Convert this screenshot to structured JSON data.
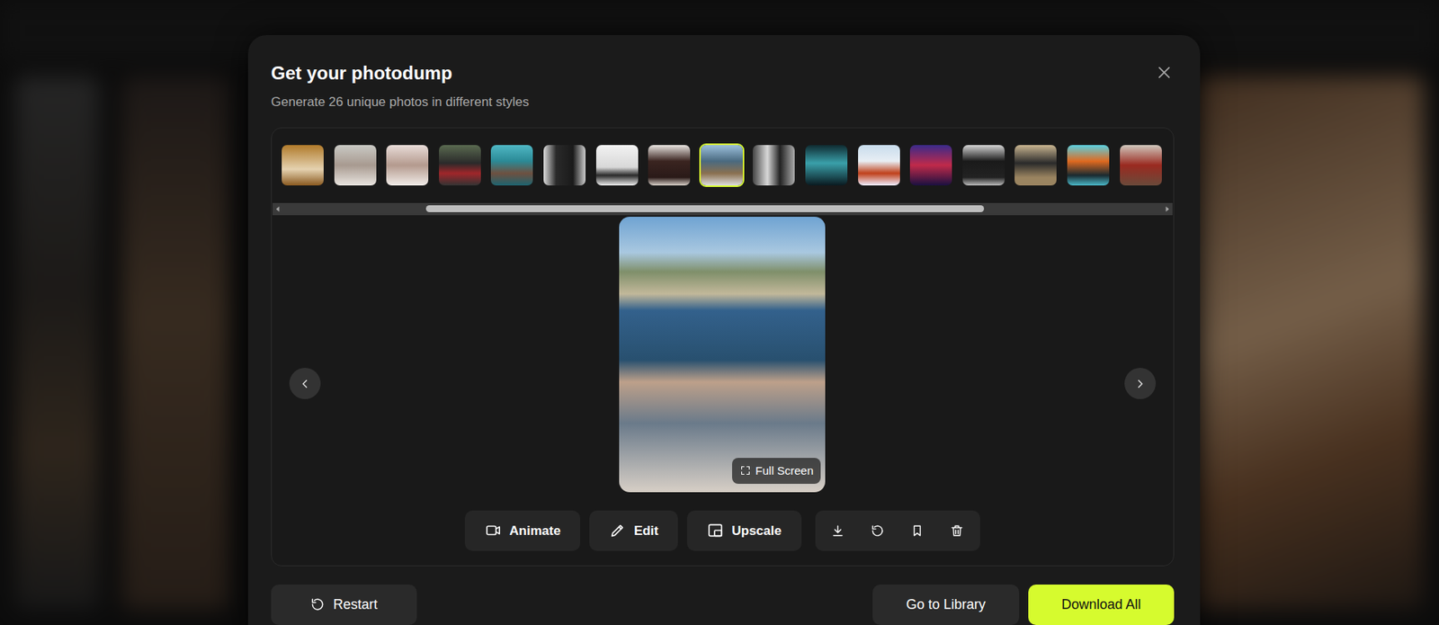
{
  "modal": {
    "title": "Get your photodump",
    "subtitle": "Generate 26 unique photos in different styles"
  },
  "thumbnails": [
    {
      "selected": false
    },
    {
      "selected": false
    },
    {
      "selected": false
    },
    {
      "selected": false
    },
    {
      "selected": false
    },
    {
      "selected": false
    },
    {
      "selected": false
    },
    {
      "selected": false
    },
    {
      "selected": true
    },
    {
      "selected": false
    },
    {
      "selected": false
    },
    {
      "selected": false
    },
    {
      "selected": false
    },
    {
      "selected": false
    },
    {
      "selected": false
    },
    {
      "selected": false
    },
    {
      "selected": false
    }
  ],
  "scrollbar": {
    "start": 0.16,
    "level": 0.64
  },
  "preview": {
    "full_screen": "Full Screen"
  },
  "actions": [
    {
      "label": "Animate"
    },
    {
      "label": "Edit"
    },
    {
      "label": "Upscale"
    }
  ],
  "footer": {
    "restart": "Restart",
    "library": "Go to Library",
    "download_all": "Download All"
  }
}
